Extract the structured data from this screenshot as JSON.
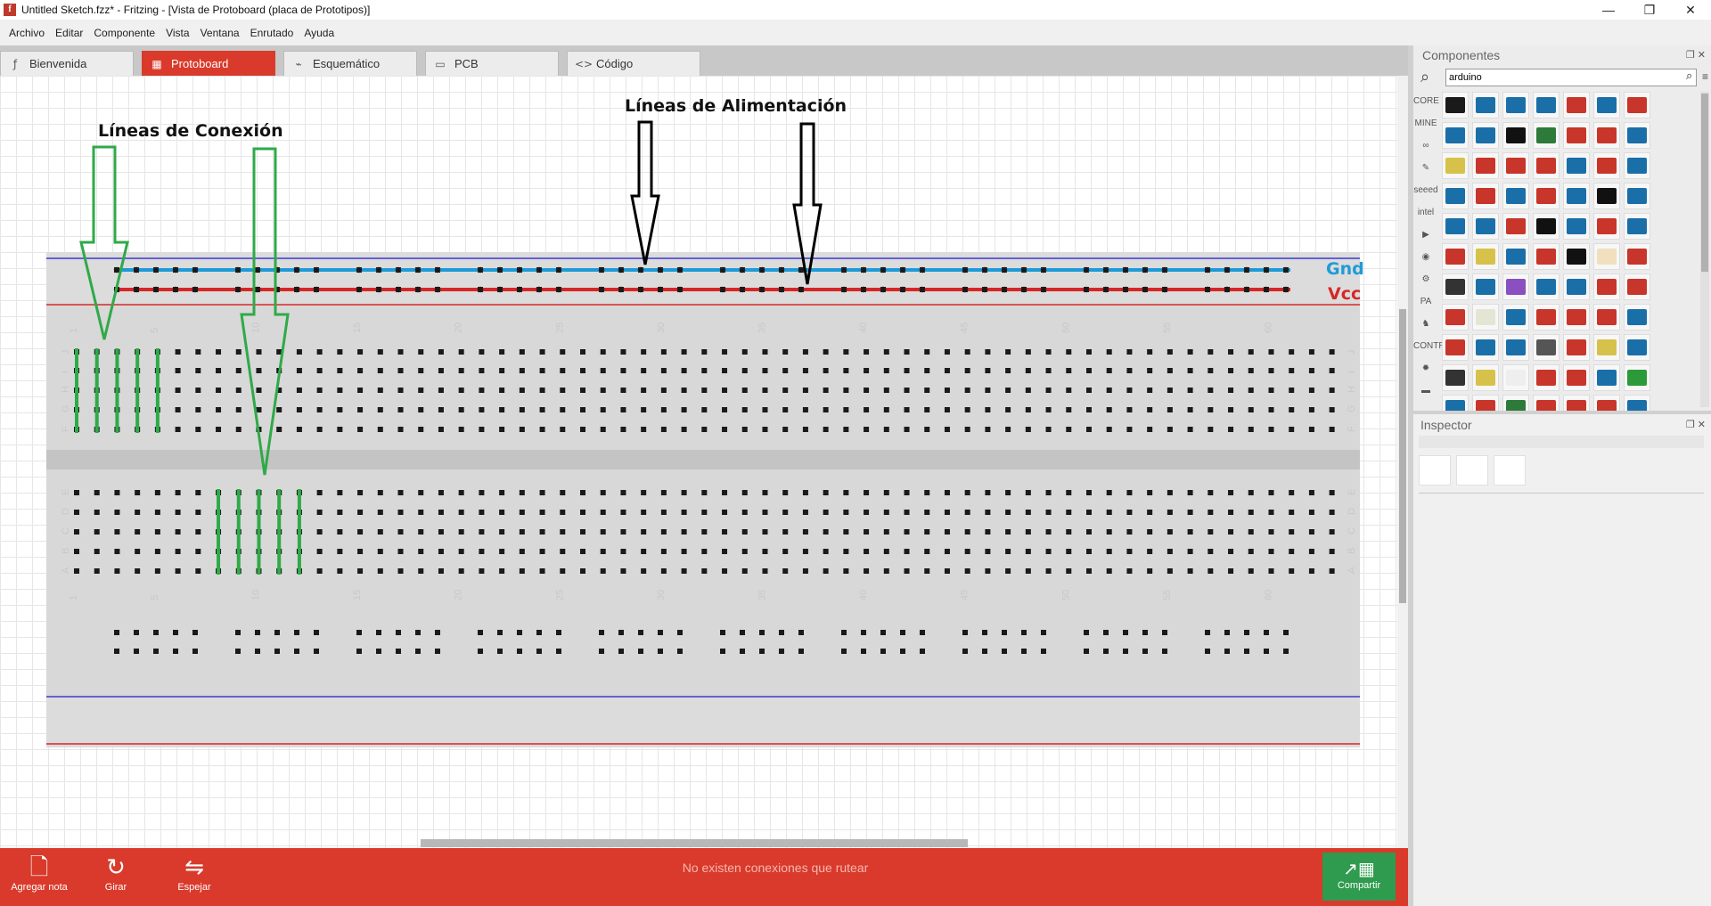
{
  "window": {
    "title": "Untitled Sketch.fzz* - Fritzing - [Vista de Protoboard (placa de Prototipos)]",
    "app_icon": "f",
    "controls": [
      "minimize-icon",
      "restore-icon",
      "close-icon"
    ]
  },
  "menu": [
    "Archivo",
    "Editar",
    "Componente",
    "Vista",
    "Ventana",
    "Enrutado",
    "Ayuda"
  ],
  "tabs": [
    {
      "label": "Bienvenida",
      "icon": "fritzing-f-icon",
      "glyph": "ƒ",
      "active": false
    },
    {
      "label": "Protoboard",
      "icon": "breadboard-icon",
      "glyph": "▦",
      "active": true
    },
    {
      "label": "Esquemático",
      "icon": "resistor-icon",
      "glyph": "⌁",
      "active": false
    },
    {
      "label": "PCB",
      "icon": "pcb-icon",
      "glyph": "▭",
      "active": false
    },
    {
      "label": "Código",
      "icon": "code-icon",
      "glyph": "<>",
      "active": false
    }
  ],
  "annotations": {
    "connection_lines": "Líneas de Conexión",
    "power_lines": "Líneas de Alimentación",
    "gnd": "Gnd",
    "vcc": "Vcc",
    "colors": {
      "gnd": "#1e9bd7",
      "vcc": "#d62728",
      "connection_arrow": "#2faa48",
      "power_arrow": "#000000"
    }
  },
  "breadboard": {
    "column_numbers": [
      "1",
      "5",
      "10",
      "15",
      "20",
      "25",
      "30",
      "35",
      "40",
      "45",
      "50",
      "55",
      "60"
    ],
    "top_rows": [
      "J",
      "I",
      "H",
      "G",
      "F"
    ],
    "bottom_rows": [
      "E",
      "D",
      "C",
      "B",
      "A"
    ],
    "columns": 63
  },
  "logo": "fritzing",
  "bottom_bar": {
    "buttons": [
      {
        "label": "Agregar nota",
        "icon": "note-icon",
        "glyph": "🗋"
      },
      {
        "label": "Girar",
        "icon": "rotate-icon",
        "glyph": "↻"
      },
      {
        "label": "Espejar",
        "icon": "mirror-icon",
        "glyph": "⇋"
      }
    ],
    "status": "No existen conexiones que rutear",
    "share_label": "Compartir",
    "share_glyph": "↗▦"
  },
  "components_panel": {
    "title": "Componentes",
    "search_value": "arduino",
    "bins": [
      "CORE",
      "MINE",
      "∞",
      "✎",
      "seeed",
      "intel",
      "▶",
      "◉",
      "⚙",
      "PA",
      "♞",
      "CONTRIB",
      "✹",
      "▬"
    ],
    "part_colors": [
      "#1a1a1a",
      "#1b6fa8",
      "#1b6fa8",
      "#1b6fa8",
      "#c8352a",
      "#1b6fa8",
      "#c8352a",
      "#1b6fa8",
      "#1b6fa8",
      "#111111",
      "#2d7a3a",
      "#c8352a",
      "#c8352a",
      "#1b6fa8",
      "#d6c24a",
      "#c8352a",
      "#c8352a",
      "#c8352a",
      "#1b6fa8",
      "#c8352a",
      "#1b6fa8",
      "#1b6fa8",
      "#c8352a",
      "#1b6fa8",
      "#c8352a",
      "#1b6fa8",
      "#111111",
      "#1b6fa8",
      "#1b6fa8",
      "#1b6fa8",
      "#c8352a",
      "#111111",
      "#1b6fa8",
      "#c8352a",
      "#1b6fa8",
      "#c8352a",
      "#d6c24a",
      "#1b6fa8",
      "#c8352a",
      "#111111",
      "#f0e0c0",
      "#c8352a",
      "#333333",
      "#1b6fa8",
      "#8a4fc0",
      "#1b6fa8",
      "#1b6fa8",
      "#c8352a",
      "#c8352a",
      "#c8352a",
      "#e5e5d5",
      "#1b6fa8",
      "#c8352a",
      "#c8352a",
      "#c8352a",
      "#1b6fa8",
      "#c8352a",
      "#1b6fa8",
      "#1b6fa8",
      "#555555",
      "#c8352a",
      "#d6c24a",
      "#1b6fa8",
      "#333333",
      "#d6c24a",
      "#eeeeee",
      "#c8352a",
      "#c8352a",
      "#1b6fa8",
      "#2d9a3a",
      "#1b6fa8",
      "#c8352a",
      "#2d7a3a",
      "#c8352a",
      "#c8352a",
      "#c8352a",
      "#1b6fa8"
    ]
  },
  "inspector": {
    "title": "Inspector"
  }
}
